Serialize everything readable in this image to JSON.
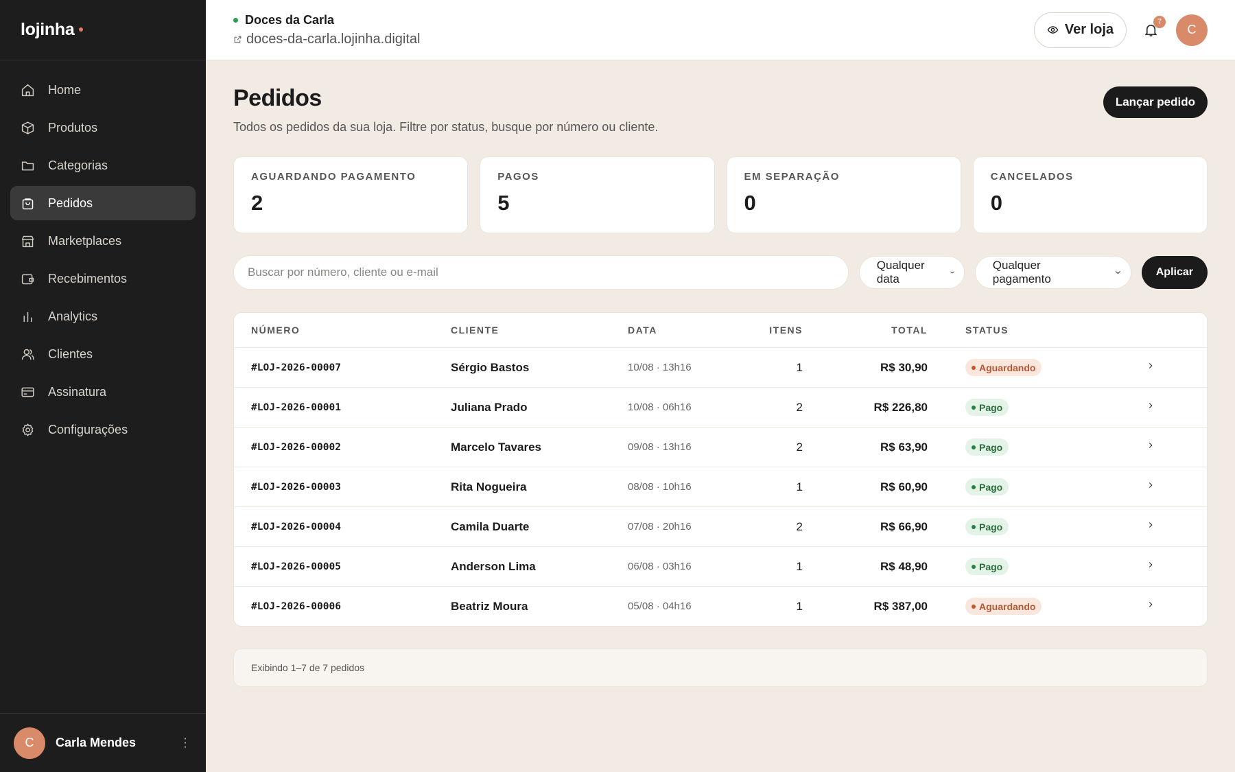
{
  "brand": {
    "name": "lojinha",
    "accent": "#e07a63"
  },
  "sidebar": {
    "items": [
      {
        "label": "Home",
        "icon": "home-icon"
      },
      {
        "label": "Produtos",
        "icon": "box-icon"
      },
      {
        "label": "Categorias",
        "icon": "folder-icon"
      },
      {
        "label": "Pedidos",
        "icon": "shopping-bag-icon",
        "active": true
      },
      {
        "label": "Marketplaces",
        "icon": "store-icon"
      },
      {
        "label": "Recebimentos",
        "icon": "wallet-icon"
      },
      {
        "label": "Analytics",
        "icon": "bar-chart-icon"
      },
      {
        "label": "Clientes",
        "icon": "users-icon"
      },
      {
        "label": "Assinatura",
        "icon": "credit-card-icon"
      },
      {
        "label": "Configurações",
        "icon": "gear-icon"
      }
    ],
    "user": {
      "initial": "C",
      "name": "Carla Mendes"
    }
  },
  "topbar": {
    "store_name": "Doces da Carla",
    "store_url": "doces-da-carla.lojinha.digital",
    "view_store_label": "Ver loja",
    "notifications_count": "7",
    "avatar_initial": "C"
  },
  "page": {
    "title": "Pedidos",
    "subtitle": "Todos os pedidos da sua loja. Filtre por status, busque por número ou cliente.",
    "primary_action": "Lançar pedido"
  },
  "stats": [
    {
      "label": "AGUARDANDO PAGAMENTO",
      "value": "2"
    },
    {
      "label": "PAGOS",
      "value": "5"
    },
    {
      "label": "EM SEPARAÇÃO",
      "value": "0"
    },
    {
      "label": "CANCELADOS",
      "value": "0"
    }
  ],
  "filters": {
    "search_placeholder": "Buscar por número, cliente ou e-mail",
    "date_selected": "Qualquer data",
    "payment_selected": "Qualquer pagamento",
    "apply_label": "Aplicar"
  },
  "table": {
    "columns": [
      "NÚMERO",
      "CLIENTE",
      "DATA",
      "ITENS",
      "TOTAL",
      "STATUS"
    ],
    "rows": [
      {
        "number": "#LOJ-2026-00007",
        "client": "Sérgio Bastos",
        "date": "10/08 · 13h16",
        "items": "1",
        "total": "R$ 30,90",
        "status": "Aguardando",
        "status_kind": "pending"
      },
      {
        "number": "#LOJ-2026-00001",
        "client": "Juliana Prado",
        "date": "10/08 · 06h16",
        "items": "2",
        "total": "R$ 226,80",
        "status": "Pago",
        "status_kind": "paid"
      },
      {
        "number": "#LOJ-2026-00002",
        "client": "Marcelo Tavares",
        "date": "09/08 · 13h16",
        "items": "2",
        "total": "R$ 63,90",
        "status": "Pago",
        "status_kind": "paid"
      },
      {
        "number": "#LOJ-2026-00003",
        "client": "Rita Nogueira",
        "date": "08/08 · 10h16",
        "items": "1",
        "total": "R$ 60,90",
        "status": "Pago",
        "status_kind": "paid"
      },
      {
        "number": "#LOJ-2026-00004",
        "client": "Camila Duarte",
        "date": "07/08 · 20h16",
        "items": "2",
        "total": "R$ 66,90",
        "status": "Pago",
        "status_kind": "paid"
      },
      {
        "number": "#LOJ-2026-00005",
        "client": "Anderson Lima",
        "date": "06/08 · 03h16",
        "items": "1",
        "total": "R$ 48,90",
        "status": "Pago",
        "status_kind": "paid"
      },
      {
        "number": "#LOJ-2026-00006",
        "client": "Beatriz Moura",
        "date": "05/08 · 04h16",
        "items": "1",
        "total": "R$ 387,00",
        "status": "Aguardando",
        "status_kind": "pending"
      }
    ]
  },
  "footer": {
    "summary": "Exibindo 1–7 de 7 pedidos"
  }
}
